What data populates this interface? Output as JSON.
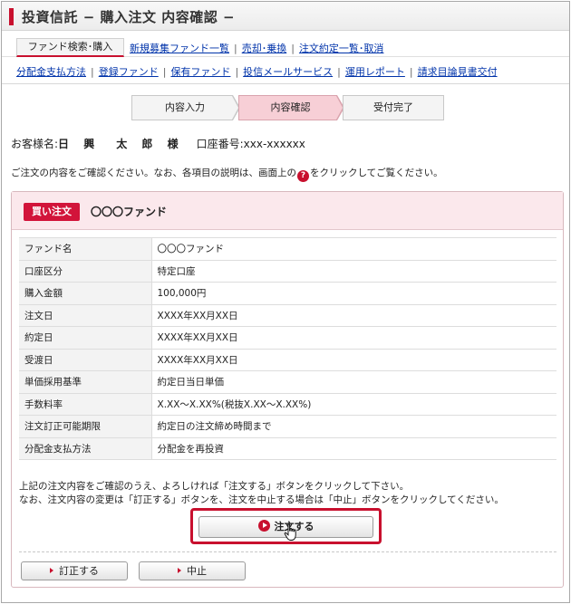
{
  "header": {
    "title": "投資信託 − 購入注文 内容確認 −"
  },
  "nav": {
    "active_tab": "ファンド検索･購入",
    "row1": [
      "新規募集ファンド一覧",
      "売却･乗換",
      "注文約定一覧･取消"
    ],
    "row2": [
      "分配金支払方法",
      "登録ファンド",
      "保有ファンド",
      "投信メールサービス",
      "運用レポート",
      "請求目論見書交付"
    ]
  },
  "steps": [
    "内容入力",
    "内容確認",
    "受付完了"
  ],
  "customer": {
    "label": "お客様名:",
    "name": "日 興　太 郎 様",
    "account": "口座番号:xxx-xxxxxx"
  },
  "instruction": {
    "before": "ご注文の内容をご確認ください。なお、各項目の説明は、画面上の",
    "icon": "?",
    "after": "をクリックしてご覧ください。"
  },
  "order": {
    "badge": "買い注文",
    "fund_name": "〇〇〇ファンド",
    "rows": [
      {
        "key": "ファンド名",
        "value": "〇〇〇ファンド"
      },
      {
        "key": "口座区分",
        "value": "特定口座"
      },
      {
        "key": "購入金額",
        "value": "100,000円"
      },
      {
        "key": "注文日",
        "value": "XXXX年XX月XX日"
      },
      {
        "key": "約定日",
        "value": "XXXX年XX月XX日"
      },
      {
        "key": "受渡日",
        "value": "XXXX年XX月XX日"
      },
      {
        "key": "単価採用基準",
        "value": "約定日当日単価"
      },
      {
        "key": "手数料率",
        "value": "X.XX〜X.XX%(税抜X.XX〜X.XX%)"
      },
      {
        "key": "注文訂正可能期限",
        "value": "約定日の注文締め時間まで"
      },
      {
        "key": "分配金支払方法",
        "value": "分配金を再投資"
      }
    ],
    "note_line1": "上記の注文内容をご確認のうえ、よろしければ「注文する」ボタンをクリックして下さい。",
    "note_line2": "なお、注文内容の変更は「訂正する」ボタンを、注文を中止する場合は「中止」ボタンをクリックしてください。",
    "confirm_label": "注文する",
    "correct_label": "訂正する",
    "cancel_label": "中止"
  },
  "colors": {
    "accent": "#c8102e",
    "link": "#0033aa",
    "step_active": "#f7cfd6",
    "panel_head": "#fbe8ec"
  }
}
